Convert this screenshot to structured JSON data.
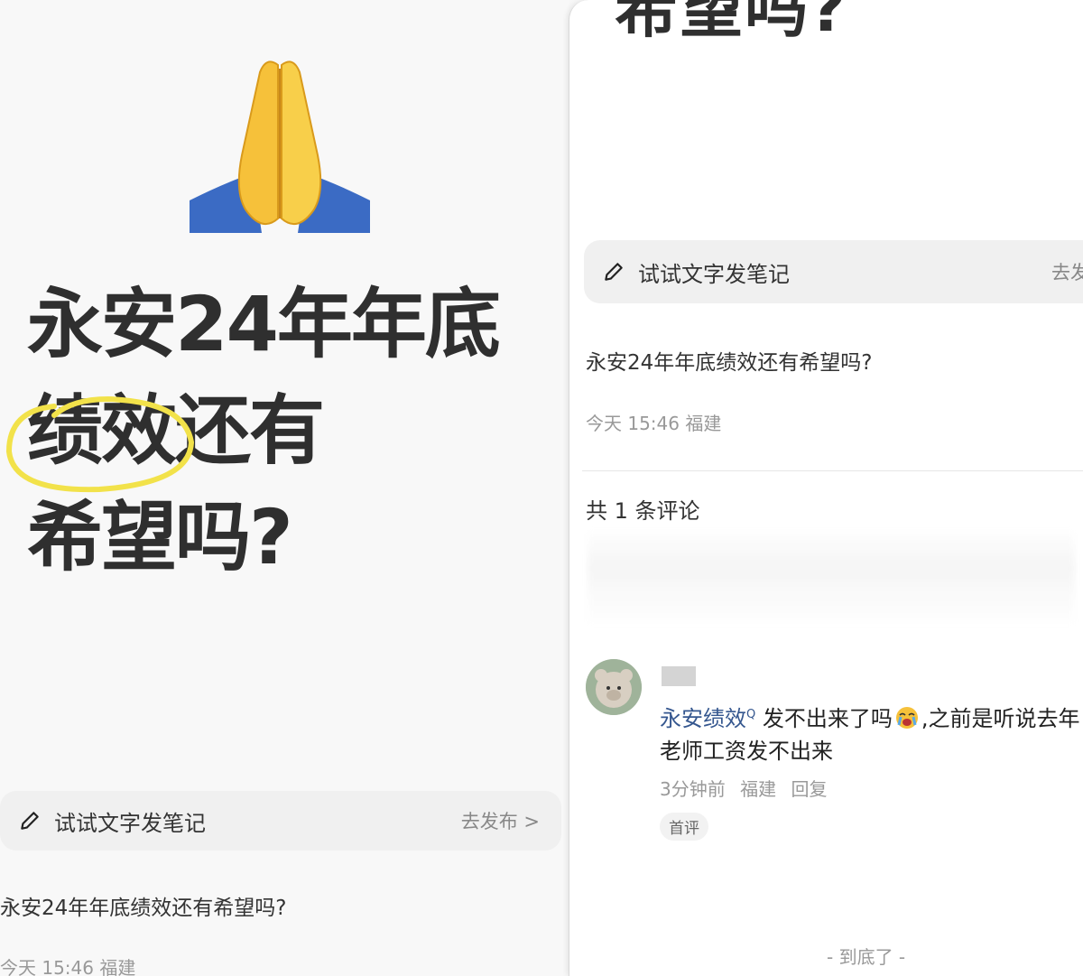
{
  "left": {
    "big_title_lines": [
      "永安24年年底",
      "绩效还有",
      "希望吗?"
    ],
    "compose": {
      "label": "试试文字发笔记",
      "action": "去发布 >"
    },
    "post": {
      "title": "永安24年年底绩效还有希望吗?",
      "meta": "今天 15:46 福建"
    }
  },
  "right": {
    "top_cut_title": "希望吗?",
    "compose": {
      "label": "试试文字发笔记",
      "action": "去发"
    },
    "post": {
      "title": "永安24年年底绩效还有希望吗?",
      "meta": "今天 15:46 福建"
    },
    "comments_header": "共 1 条评论",
    "comment": {
      "topic": "永安绩效",
      "text_part1": "发不出来了吗",
      "text_part2": ",之前是听说去年老师工资发不出来",
      "meta_time": "3分钟前",
      "meta_location": "福建",
      "meta_reply": "回复",
      "badge": "首评"
    },
    "end_hint": "- 到底了 -"
  },
  "icons": [
    "folded-hands-icon",
    "pencil-icon",
    "chevron-right-icon",
    "crying-face-icon",
    "avatar-bear-icon"
  ]
}
